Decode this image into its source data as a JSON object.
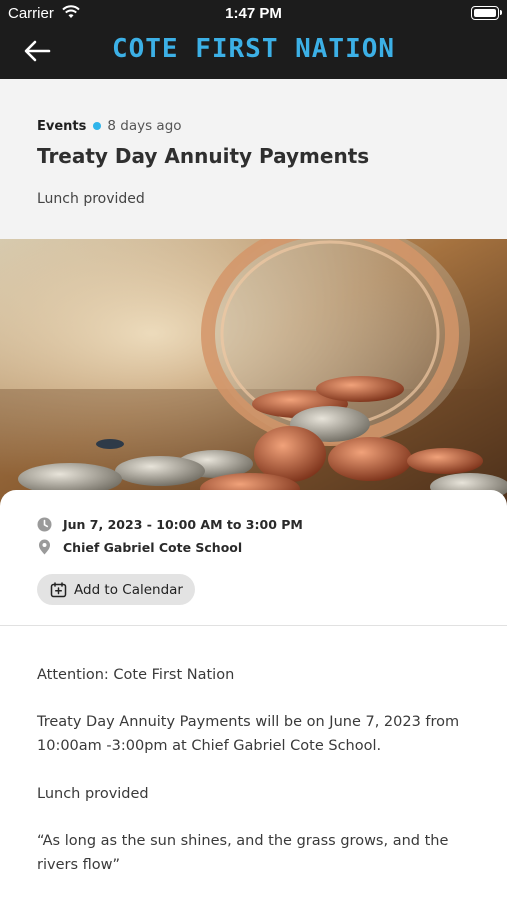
{
  "status_bar": {
    "carrier": "Carrier",
    "time": "1:47 PM"
  },
  "app_bar": {
    "brand": "COTE FIRST NATION"
  },
  "post": {
    "category": "Events",
    "age": "8 days ago",
    "title": "Treaty Day Annuity Payments",
    "subtitle": "Lunch provided"
  },
  "event": {
    "datetime": "Jun 7, 2023 - 10:00 AM to 3:00 PM",
    "location": "Chief Gabriel Cote School",
    "calendar_label": "Add to Calendar"
  },
  "body": {
    "p1": "Attention: Cote First Nation",
    "p2": "Treaty Day Annuity Payments will be on June 7, 2023 from 10:00am -3:00pm at Chief Gabriel Cote School.",
    "p3": "Lunch provided",
    "p4": "“As long as the sun shines, and the grass grows, and the rivers flow”"
  },
  "colors": {
    "accent": "#3cb0e6",
    "topbar": "#1c1c1c",
    "header_bg": "#f3f3f3"
  }
}
